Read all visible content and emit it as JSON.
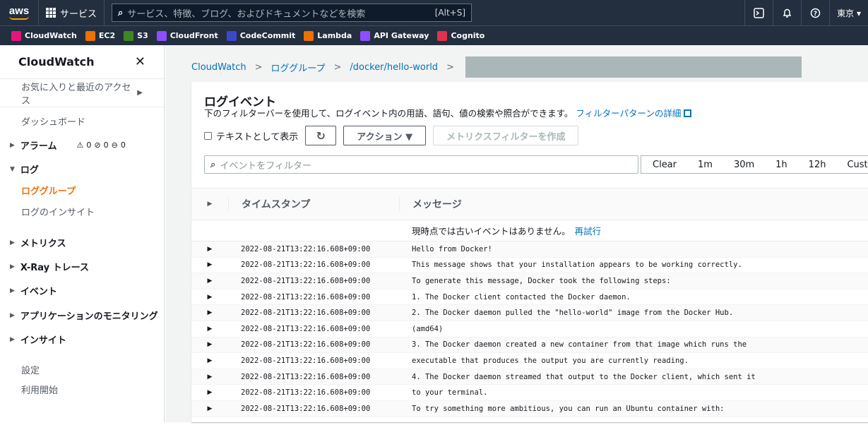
{
  "topnav": {
    "logo": "aws",
    "services_label": "サービス",
    "search_placeholder": "サービス、特徴、ブログ、およびドキュメントなどを検索",
    "search_shortcut": "[Alt+S]",
    "region": "東京 ▾"
  },
  "favorites": [
    {
      "label": "CloudWatch",
      "color": "#e7157b"
    },
    {
      "label": "EC2",
      "color": "#ed7100"
    },
    {
      "label": "S3",
      "color": "#3f8624"
    },
    {
      "label": "CloudFront",
      "color": "#8c4fff"
    },
    {
      "label": "CodeCommit",
      "color": "#3b48cc"
    },
    {
      "label": "Lambda",
      "color": "#ed7100"
    },
    {
      "label": "API Gateway",
      "color": "#8c4fff"
    },
    {
      "label": "Cognito",
      "color": "#dd344c"
    }
  ],
  "sidebar": {
    "title": "CloudWatch",
    "favorites_recent": "お気に入りと最近のアクセス",
    "dashboard": "ダッシュボード",
    "alarms": "アラーム",
    "alarm_counts": [
      "0",
      "0",
      "0"
    ],
    "logs": "ログ",
    "log_groups": "ロググループ",
    "log_insights": "ログのインサイト",
    "metrics": "メトリクス",
    "xray": "X-Ray トレース",
    "events": "イベント",
    "app_monitoring": "アプリケーションのモニタリング",
    "insights": "インサイト",
    "settings": "設定",
    "getting_started": "利用開始"
  },
  "breadcrumb": [
    "CloudWatch",
    "ロググループ",
    "/docker/hello-world"
  ],
  "panel": {
    "title": "ログイベント",
    "description": "下のフィルターバーを使用して、ログイベント内の用語、語句、値の検索や照合ができます。",
    "description_link": "フィルターパターンの詳細",
    "show_as_text": "テキストとして表示",
    "actions_label": "アクション ▼",
    "create_metric_filter": "メトリクスフィルターを作成",
    "filter_placeholder": "イベントをフィルター",
    "time_options": [
      "Clear",
      "1m",
      "30m",
      "1h",
      "12h",
      "Custo"
    ],
    "col_timestamp": "タイムスタンプ",
    "col_message": "メッセージ",
    "no_older": "現時点では古いイベントはありません。",
    "retry": "再試行"
  },
  "rows": [
    {
      "ts": "2022-08-21T13:22:16.608+09:00",
      "msg": "Hello from Docker!"
    },
    {
      "ts": "2022-08-21T13:22:16.608+09:00",
      "msg": "This message shows that your installation appears to be working correctly."
    },
    {
      "ts": "2022-08-21T13:22:16.608+09:00",
      "msg": "To generate this message, Docker took the following steps:"
    },
    {
      "ts": "2022-08-21T13:22:16.608+09:00",
      "msg": "1. The Docker client contacted the Docker daemon."
    },
    {
      "ts": "2022-08-21T13:22:16.608+09:00",
      "msg": "2. The Docker daemon pulled the \"hello-world\" image from the Docker Hub."
    },
    {
      "ts": "2022-08-21T13:22:16.608+09:00",
      "msg": "(amd64)"
    },
    {
      "ts": "2022-08-21T13:22:16.608+09:00",
      "msg": "3. The Docker daemon created a new container from that image which runs the"
    },
    {
      "ts": "2022-08-21T13:22:16.608+09:00",
      "msg": "executable that produces the output you are currently reading."
    },
    {
      "ts": "2022-08-21T13:22:16.608+09:00",
      "msg": "4. The Docker daemon streamed that output to the Docker client, which sent it"
    },
    {
      "ts": "2022-08-21T13:22:16.608+09:00",
      "msg": "to your terminal."
    },
    {
      "ts": "2022-08-21T13:22:16.608+09:00",
      "msg": "To try something more ambitious, you can run an Ubuntu container with:"
    }
  ]
}
